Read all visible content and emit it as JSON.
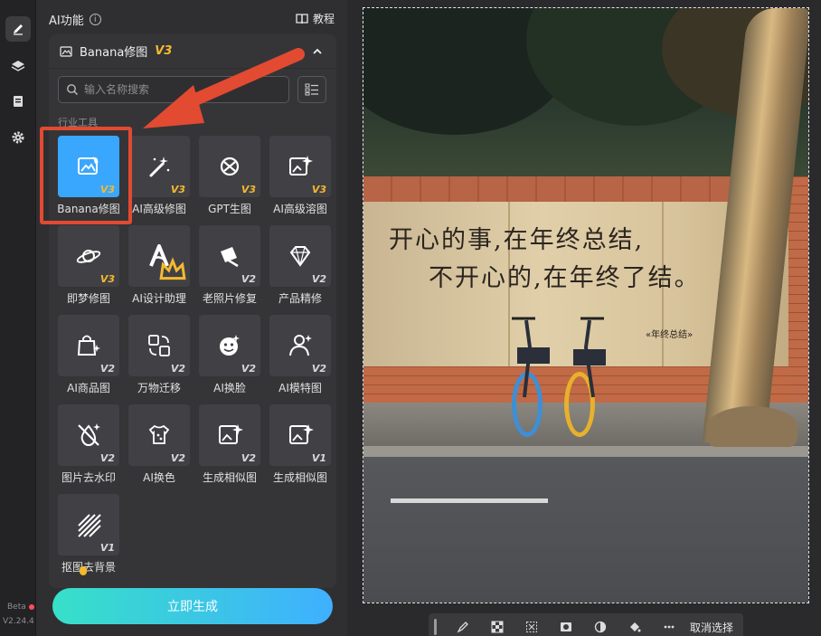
{
  "sidebar": {
    "icons": [
      "brush-icon",
      "layers-icon",
      "notebook-icon",
      "gear-icon"
    ],
    "beta": "Beta",
    "version": "V2.24.4"
  },
  "panel": {
    "title": "AI功能",
    "tutorial": "教程",
    "tool_name": "Banana修图",
    "tool_version": "V3",
    "search_placeholder": "输入名称搜索",
    "section": "行业工具",
    "generate": "立即生成"
  },
  "tools": [
    {
      "label": "Banana修图",
      "version": "V3",
      "gold": true,
      "icon": "image-edit-icon",
      "selected": true
    },
    {
      "label": "AI高级修图",
      "version": "V3",
      "gold": true,
      "icon": "magic-wand-icon"
    },
    {
      "label": "GPT生图",
      "version": "V3",
      "gold": true,
      "icon": "gpt-knot-icon"
    },
    {
      "label": "AI高级溶图",
      "version": "V3",
      "gold": true,
      "icon": "image-sparkle-icon"
    },
    {
      "label": "即梦修图",
      "version": "V3",
      "gold": true,
      "icon": "dream-planet-icon"
    },
    {
      "label": "AI设计助理",
      "version": "",
      "gold": false,
      "icon": "design-a-icon",
      "crown": true
    },
    {
      "label": "老照片修复",
      "version": "V2",
      "gold": false,
      "icon": "photo-restore-icon"
    },
    {
      "label": "产品精修",
      "version": "V2",
      "gold": false,
      "icon": "gem-icon"
    },
    {
      "label": "AI商品图",
      "version": "V2",
      "gold": false,
      "icon": "shopping-bag-icon"
    },
    {
      "label": "万物迁移",
      "version": "V2",
      "gold": false,
      "icon": "transfer-icon"
    },
    {
      "label": "AI换脸",
      "version": "V2",
      "gold": false,
      "icon": "face-swap-icon"
    },
    {
      "label": "AI模特图",
      "version": "V2",
      "gold": false,
      "icon": "model-icon"
    },
    {
      "label": "图片去水印",
      "version": "V2",
      "gold": false,
      "icon": "watermark-remove-icon"
    },
    {
      "label": "AI换色",
      "version": "V2",
      "gold": false,
      "icon": "palette-shirt-icon"
    },
    {
      "label": "生成相似图",
      "version": "V2",
      "gold": false,
      "icon": "similar-image-icon"
    },
    {
      "label": "生成相似图",
      "version": "V1",
      "gold": false,
      "icon": "similar-image-icon"
    },
    {
      "label": "抠图去背景",
      "version": "V1",
      "gold": false,
      "icon": "cutout-icon"
    }
  ],
  "canvas": {
    "wall_text_line1": "开心的事,在年终总结,",
    "wall_text_line2": "不开心的,在年终了结。",
    "wall_signature": "«年终总结»"
  },
  "bottom_bar": {
    "icons": [
      "brush-icon",
      "checker-icon",
      "select-icon",
      "mask-icon",
      "contrast-icon",
      "bucket-icon",
      "more-icon"
    ],
    "deselect": "取消选择"
  },
  "colors": {
    "accent": "#3aa7ff",
    "highlight": "#e24a31",
    "gold": "#f5b92f"
  }
}
